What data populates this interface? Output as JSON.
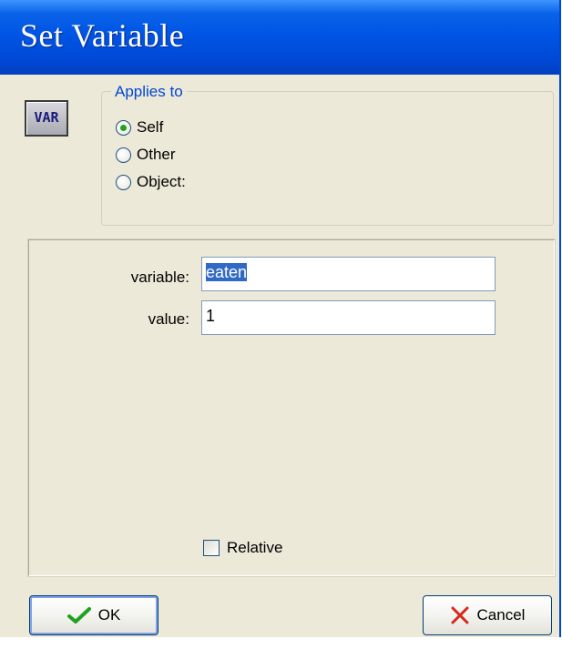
{
  "window": {
    "title": "Set Variable"
  },
  "icon": {
    "label": "VAR"
  },
  "applies_to": {
    "legend": "Applies to",
    "options": [
      "Self",
      "Other",
      "Object:"
    ],
    "selected": "Self"
  },
  "fields": {
    "variable_label": "variable:",
    "variable_value": "eaten",
    "value_label": "value:",
    "value_value": "1"
  },
  "relative": {
    "label": "Relative",
    "checked": false
  },
  "buttons": {
    "ok": "OK",
    "cancel": "Cancel"
  },
  "colors": {
    "titlebar": "#0055e5",
    "dialog_bg": "#ece9d8",
    "accent": "#0046d5",
    "check_green": "#21a121",
    "cancel_red": "#d42a1e"
  }
}
